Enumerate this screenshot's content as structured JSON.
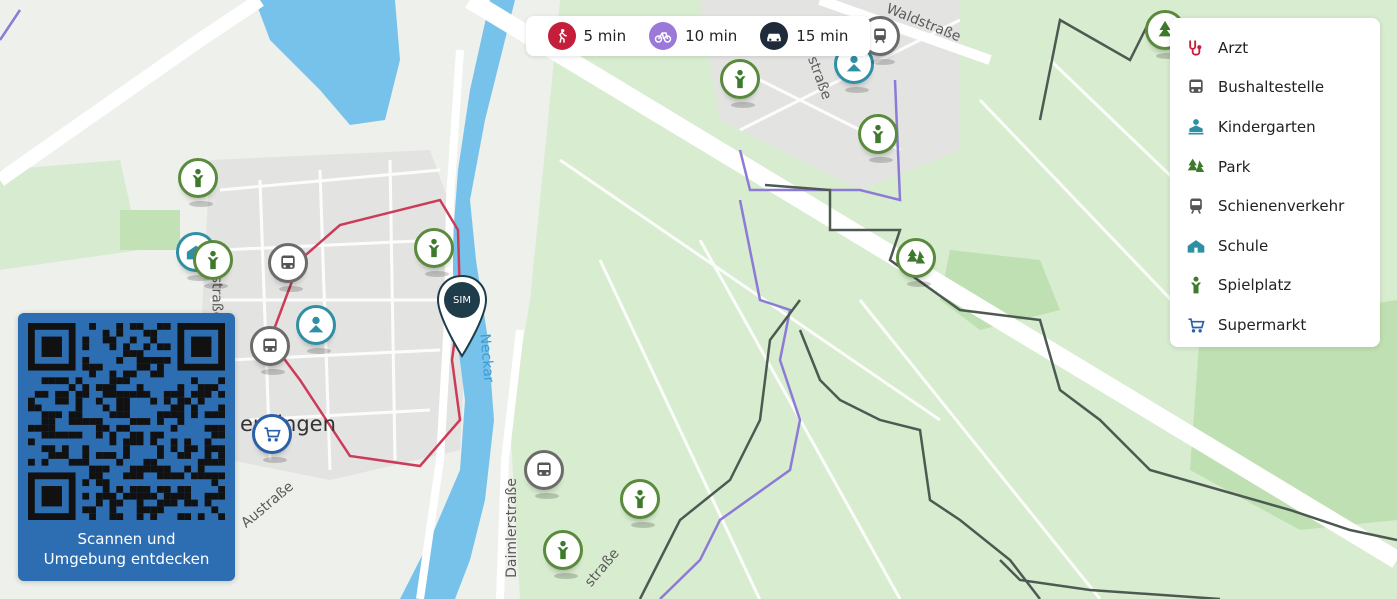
{
  "travel_times": [
    {
      "label": "5 min",
      "mode": "walk-icon",
      "color": "#c41e3a"
    },
    {
      "label": "10 min",
      "mode": "bike-icon",
      "color": "#9a79d8"
    },
    {
      "label": "15 min",
      "mode": "car-icon",
      "color": "#1f2b3a"
    }
  ],
  "poi_legend": [
    {
      "label": "Arzt",
      "icon": "stethoscope-icon",
      "color": "#c41e3a"
    },
    {
      "label": "Bushaltestelle",
      "icon": "bus-icon",
      "color": "#555555"
    },
    {
      "label": "Kindergarten",
      "icon": "kindergarten-icon",
      "color": "#2f8fa5"
    },
    {
      "label": "Park",
      "icon": "tree-icon",
      "color": "#3d7a2c"
    },
    {
      "label": "Schienenverkehr",
      "icon": "train-icon",
      "color": "#555555"
    },
    {
      "label": "Schule",
      "icon": "school-icon",
      "color": "#2f8fa5"
    },
    {
      "label": "Spielplatz",
      "icon": "playground-icon",
      "color": "#3d7a2c"
    },
    {
      "label": "Supermarkt",
      "icon": "cart-icon",
      "color": "#2b5fa8"
    }
  ],
  "qr_card": {
    "caption_line1": "Scannen und",
    "caption_line2": "Umgebung entdecken"
  },
  "map_labels": {
    "city": "ensingen",
    "street_waldstrasse": "Waldstraße",
    "street_austrasse": "Austraße",
    "street_daimlerstrasse": "Daimlerstraße",
    "river_neckar": "Neckar",
    "street_partial_1": "straße",
    "street_partial_2": "straße",
    "street_partial_3": "straße"
  },
  "home_marker": {
    "label": "SIM"
  }
}
